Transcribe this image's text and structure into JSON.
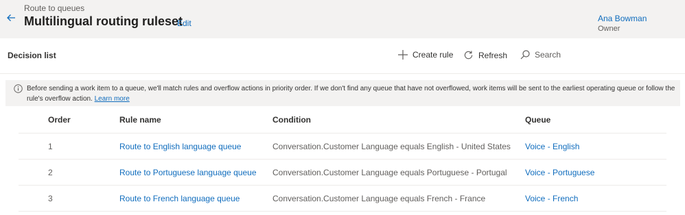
{
  "header": {
    "breadcrumb": "Route to queues",
    "title": "Multilingual routing ruleset",
    "edit_label": "Edit",
    "owner_name": "Ana Bowman",
    "owner_role": "Owner"
  },
  "commandbar": {
    "section_title": "Decision list",
    "create_label": "Create rule",
    "refresh_label": "Refresh",
    "search_placeholder": "Search"
  },
  "info": {
    "text": "Before sending a work item to a queue, we'll match rules and overflow actions in priority order. If we don't find any queue that have not overflowed, work items will be sent to the earliest operating queue or follow the rule's overflow action.",
    "link": "Learn more"
  },
  "table": {
    "headers": {
      "order": "Order",
      "rule_name": "Rule name",
      "condition": "Condition",
      "queue": "Queue"
    },
    "rows": [
      {
        "order": "1",
        "rule_name": "Route to English language queue",
        "condition": "Conversation.Customer Language equals English - United States",
        "queue": "Voice - English"
      },
      {
        "order": "2",
        "rule_name": "Route to Portuguese language queue",
        "condition": "Conversation.Customer Language equals Portuguese - Portugal",
        "queue": "Voice - Portuguese"
      },
      {
        "order": "3",
        "rule_name": "Route to French language queue",
        "condition": "Conversation.Customer Language equals French - France",
        "queue": "Voice - French"
      }
    ]
  },
  "colors": {
    "accent": "#0f6cbd",
    "header_bg": "#f3f2f1",
    "text": "#323130",
    "secondary_text": "#605e5c"
  }
}
